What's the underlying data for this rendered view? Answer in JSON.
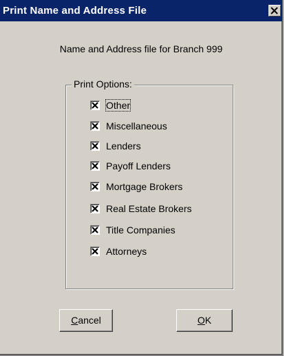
{
  "window": {
    "title": "Print Name and Address File"
  },
  "header": {
    "text": "Name and Address file for Branch 999"
  },
  "print_options": {
    "legend": "Print Options:",
    "items": [
      {
        "label": "Other",
        "checked": true
      },
      {
        "label": "Miscellaneous",
        "checked": true
      },
      {
        "label": "Lenders",
        "checked": true
      },
      {
        "label": "Payoff Lenders",
        "checked": true
      },
      {
        "label": "Mortgage Brokers",
        "checked": true
      },
      {
        "label": "Real Estate Brokers",
        "checked": true
      },
      {
        "label": "Title Companies",
        "checked": true
      },
      {
        "label": "Attorneys",
        "checked": true
      }
    ]
  },
  "buttons": {
    "cancel": {
      "mnemonic": "C",
      "rest": "ancel"
    },
    "ok": {
      "mnemonic": "O",
      "rest": "K"
    }
  },
  "colors": {
    "titlebar": "#0a246a",
    "dialog_face": "#d4d0c8"
  }
}
